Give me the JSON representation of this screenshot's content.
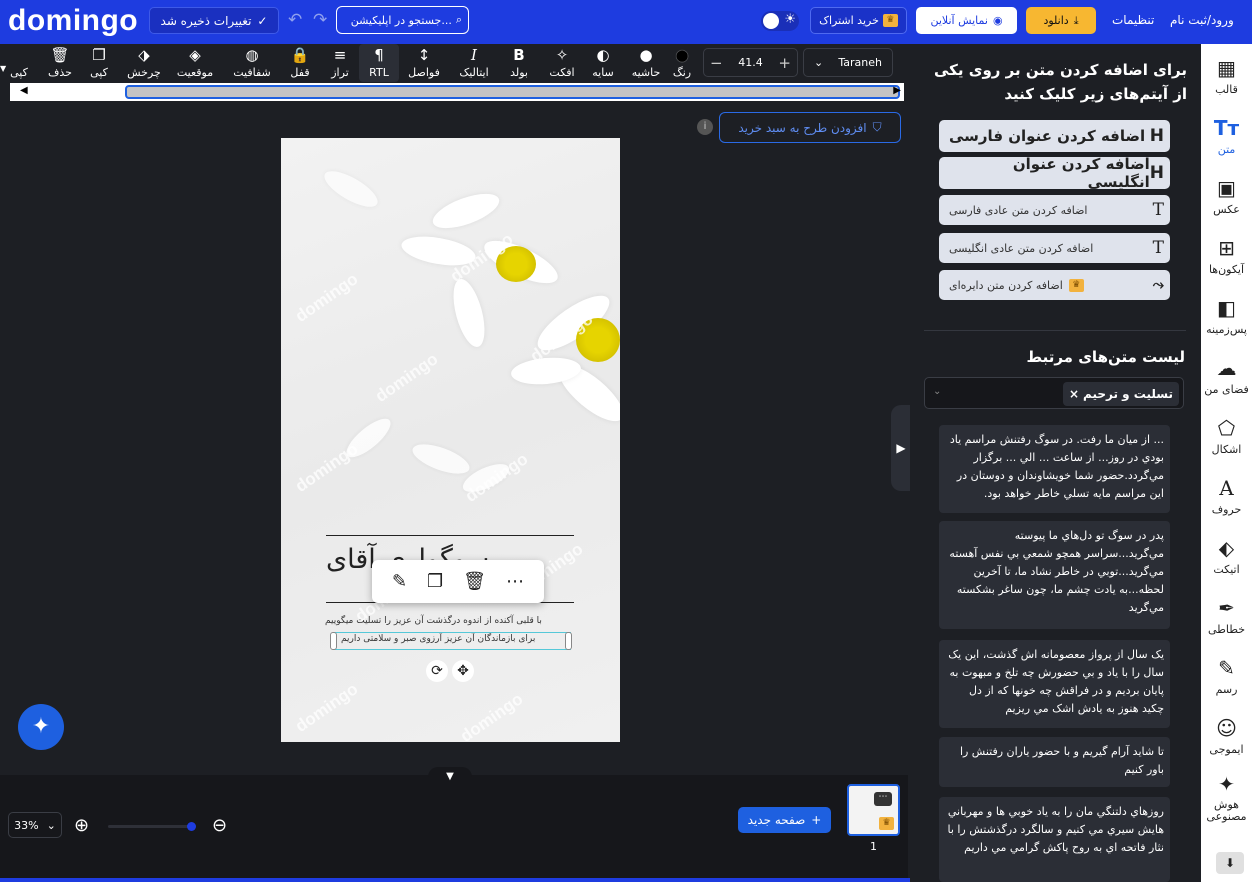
{
  "header": {
    "logo": "domingo",
    "saved_label": "تغییرات ذخیره شد",
    "search_placeholder": "جستجو در اپلیکیشن...",
    "subscription_label": "خرید اشتراک",
    "online_preview_label": "نمایش آنلاین",
    "download_label": "دانلود",
    "settings_label": "تنظیمات",
    "login_label": "ورود/ثبت نام"
  },
  "toolbar": {
    "items": [
      {
        "label": "کپی",
        "icon": "copy-icon"
      },
      {
        "label": "حذف",
        "icon": "trash-icon"
      },
      {
        "label": "کپی",
        "icon": "duplicate-icon"
      },
      {
        "label": "چرخش",
        "icon": "rotate-icon"
      },
      {
        "label": "موقعیت",
        "icon": "layers-icon"
      },
      {
        "label": "شفافیت",
        "icon": "opacity-icon"
      },
      {
        "label": "قفل",
        "icon": "lock-icon"
      },
      {
        "label": "تراز",
        "icon": "align-icon"
      },
      {
        "label": "RTL",
        "icon": "rtl-icon"
      },
      {
        "label": "فواصل",
        "icon": "spacing-icon"
      },
      {
        "label": "ایتالیک",
        "icon": "italic-icon"
      },
      {
        "label": "بولد",
        "icon": "bold-icon"
      },
      {
        "label": "افکت",
        "icon": "effect-icon"
      },
      {
        "label": "سایه",
        "icon": "shadow-icon"
      },
      {
        "label": "حاشیه",
        "icon": "border-icon"
      },
      {
        "label": "رنگ",
        "icon": "color-icon"
      }
    ],
    "font_size": "41.4",
    "font_name": "Taraneh"
  },
  "canvas": {
    "add_to_cart_label": "افزودن طرح به سبد خرید",
    "title_text": "سوگواری آقای",
    "body_line1": "با قلبی آکنده از اندوه درگذشت آن عزیز را تسلیت میگوییم",
    "body_line2": "برای بازماندگان آن عزیز آرزوی صبر و سلامتی داریم"
  },
  "bottom": {
    "zoom": "33%",
    "new_page_label": "صفحه جدید",
    "page_number": "1"
  },
  "panel": {
    "heading": "برای اضافه کردن متن بر روی یکی از آیتم‌های زیر کلیک کنید",
    "add_buttons": [
      {
        "label": "اضافه کردن عنوان فارسی",
        "icon": "H"
      },
      {
        "label": "اضافه کردن عنوان انگلیسی",
        "icon": "H"
      },
      {
        "label": "اضافه کردن متن عادی فارسی",
        "icon": "T"
      },
      {
        "label": "اضافه کردن متن عادی انگلیسی",
        "icon": "T"
      },
      {
        "label": "اضافه کردن متن دایره‌ای",
        "icon": "curve-icon"
      }
    ],
    "related_title": "لیست متن‌های مرتبط",
    "related_tag": "تسلیت و ترحیم",
    "cards": [
      "... از میان ما رفت. در سوگ رفتنش مراسم یاد بودي در روز... از ساعت ... الي ... برگزار مي‌گردد.حضور شما خويشاوندان و دوستان در اين مراسم مايه تسلي خاطر خواهد بود.",
      "پدر در سوگ تو دل‌هاي ما پيوسته مي‌گريد...سراسر همچو شمعي بي نفس آهسته مي‌گريد...توبي در خاطر نشاد ما، تا آخرين لحظه...به يادت چشم ما، چون ساغر بشکسته مي‌گريد",
      "يک سال از پرواز معصومانه اش گذشت، اين يک سال را با ياد و بي حضورش چه تلخ و مبهوت به پايان برديم و در فراقش چه خونها که از دل چکيد هنوز به يادش اشک مي ريزيم",
      "تا شايد آرام گيريم و با حضور ياران رفتنش را باور کنيم",
      "روزهاي دلتنگي مان را به ياد خوبي ها و مهرباني هايش سيري مي کنيم و سالگرد درگذشتش را با نثار فاتحه اي به روح پاکش گرامي مي داريم"
    ]
  },
  "sidebar": {
    "items": [
      {
        "label": "قالب",
        "icon": "template-icon"
      },
      {
        "label": "متن",
        "icon": "text-icon"
      },
      {
        "label": "عکس",
        "icon": "image-icon"
      },
      {
        "label": "آیکون‌ها",
        "icon": "grid-icon"
      },
      {
        "label": "پس‌زمینه",
        "icon": "background-icon"
      },
      {
        "label": "فضای من",
        "icon": "cloud-upload-icon"
      },
      {
        "label": "اشکال",
        "icon": "shapes-icon"
      },
      {
        "label": "حروف",
        "icon": "letters-icon"
      },
      {
        "label": "اتیکت",
        "icon": "tag-icon"
      },
      {
        "label": "خطاطی",
        "icon": "calligraphy-icon"
      },
      {
        "label": "رسم",
        "icon": "pencil-icon"
      },
      {
        "label": "ایموجی",
        "icon": "emoji-icon"
      },
      {
        "label": "هوش مصنوعی",
        "icon": "magic-icon"
      }
    ]
  },
  "colors": {
    "brand_blue": "#1e3ce0",
    "download_yellow": "#f7b731",
    "dark_bg": "#1d1f24"
  }
}
